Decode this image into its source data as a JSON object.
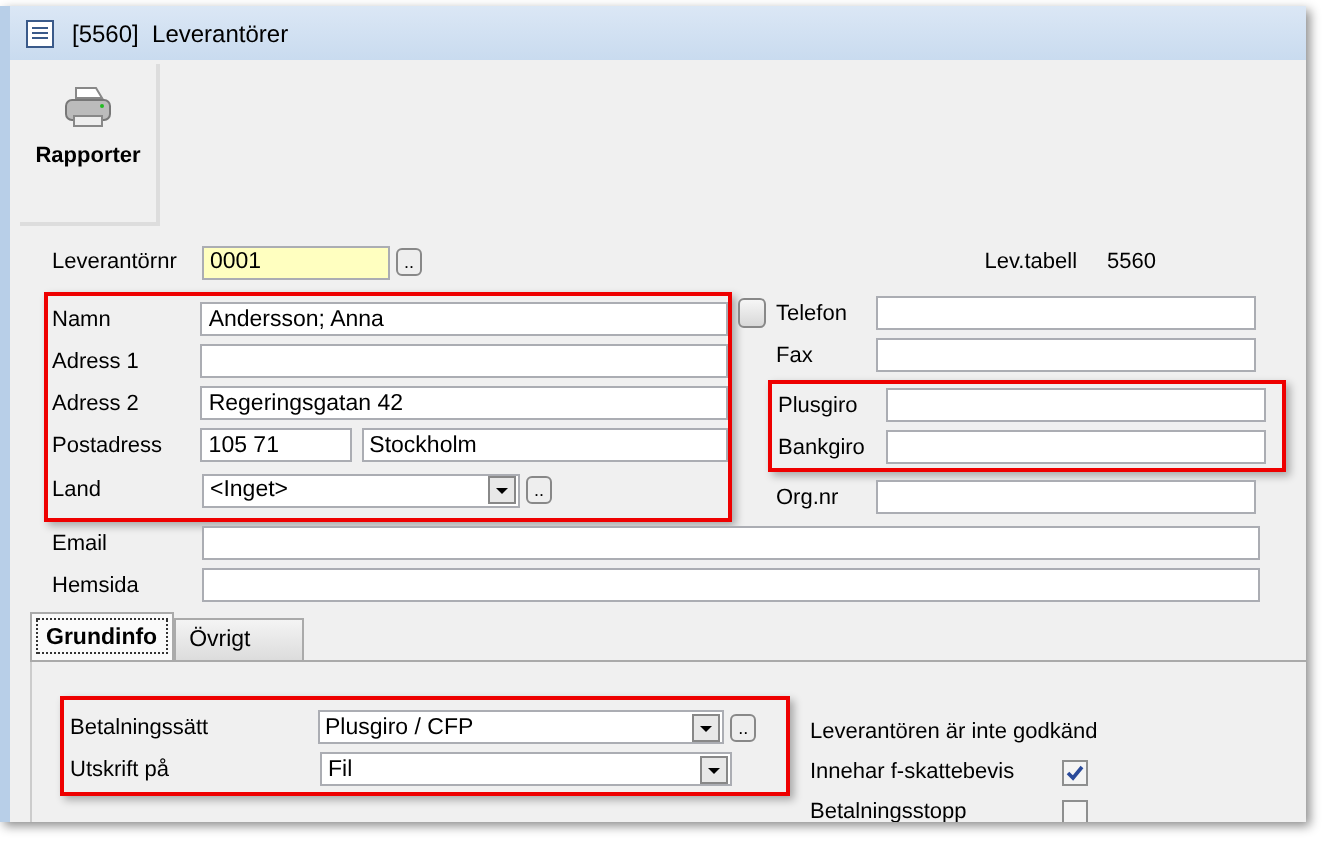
{
  "window": {
    "title": "[5560]  Leverantörer"
  },
  "toolbar": [
    {
      "label": "Rapporter"
    }
  ],
  "supplier_number": {
    "label": "Leverantörnr",
    "value": "0001",
    "button": ".."
  },
  "table_ref": {
    "label": "Lev.tabell",
    "value": "5560"
  },
  "address_fields": [
    {
      "label": "Namn",
      "value": "Andersson; Anna"
    },
    {
      "label": "Adress 1"
    },
    {
      "label": "Adress 2",
      "value": "Regeringsgatan 42"
    }
  ],
  "postal": {
    "label": "Postadress",
    "zip": "105 71",
    "city": "Stockholm"
  },
  "country": {
    "label": "Land",
    "value": "<Inget>",
    "button": ".."
  },
  "name_checkbox": {
    "checked": false
  },
  "phone_fields": [
    {
      "label": "Telefon"
    },
    {
      "label": "Fax"
    }
  ],
  "giro_fields": [
    {
      "label": "Plusgiro"
    },
    {
      "label": "Bankgiro"
    }
  ],
  "org_field": {
    "label": "Org.nr"
  },
  "web_fields": [
    {
      "label": "Email"
    },
    {
      "label": "Hemsida"
    }
  ],
  "tabs": [
    {
      "label": "Grundinfo",
      "selected": true
    },
    {
      "label": "Övrigt",
      "selected": false
    }
  ],
  "payment": [
    {
      "label": "Betalningssätt",
      "value": "Plusgiro / CFP",
      "button": ".."
    },
    {
      "label": "Utskrift på",
      "value": "Fil"
    }
  ],
  "flags": [
    {
      "kind": "note",
      "label": "Leverantören är inte godkänd"
    },
    {
      "kind": "checkbox",
      "label": "Innehar f-skattebevis",
      "checked": true
    },
    {
      "kind": "checkbox",
      "label": "Betalningsstopp",
      "checked": false
    }
  ]
}
